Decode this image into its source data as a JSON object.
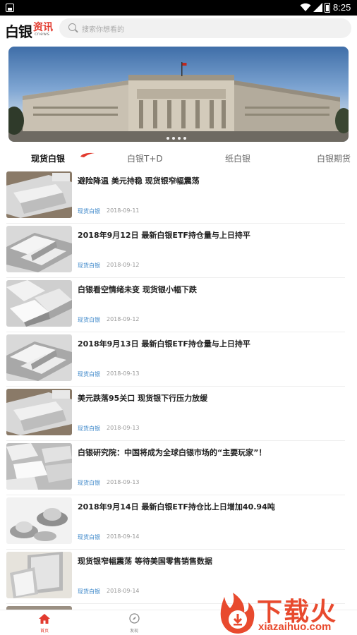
{
  "status_bar": {
    "time": "8:25"
  },
  "header": {
    "logo_main": "白银",
    "logo_accent": "资讯",
    "logo_sub": "cnews",
    "search_placeholder": "搜索你想看的"
  },
  "tabs": [
    {
      "label": "现货白银",
      "active": true
    },
    {
      "label": "白银T+D",
      "active": false
    },
    {
      "label": "纸白银",
      "active": false
    },
    {
      "label": "白银期货",
      "active": false
    }
  ],
  "news": [
    {
      "title": "避险降温 美元持稳 现货银窄幅震荡",
      "tag": "现货白银",
      "date": "2018-09-11"
    },
    {
      "title": "2018年9月12日 最新白银ETF持仓量与上日持平",
      "tag": "现货白银",
      "date": "2018-09-12"
    },
    {
      "title": "白银看空情绪未变 现货银小幅下跌",
      "tag": "现货白银",
      "date": "2018-09-12"
    },
    {
      "title": "2018年9月13日 最新白银ETF持仓量与上日持平",
      "tag": "现货白银",
      "date": "2018-09-13"
    },
    {
      "title": "美元跌落95关口 现货银下行压力放缓",
      "tag": "现货白银",
      "date": "2018-09-13"
    },
    {
      "title": "白银研究院：中国将成为全球白银市场的“主要玩家”！",
      "tag": "现货白银",
      "date": "2018-09-13"
    },
    {
      "title": "2018年9月14日 最新白银ETF持仓比上日增加40.94吨",
      "tag": "现货白银",
      "date": "2018-09-14"
    },
    {
      "title": "现货银窄幅震荡 等待美国零售销售数据",
      "tag": "现货白银",
      "date": "2018-09-14"
    }
  ],
  "bottom_nav": [
    {
      "label": "首页",
      "icon": "home-icon",
      "active": true
    },
    {
      "label": "发现",
      "icon": "compass-icon",
      "active": false
    }
  ],
  "watermark": {
    "text_cn": "下载火",
    "text_en": "xiazaihuo.com"
  },
  "colors": {
    "accent": "#e23a2e",
    "tag": "#3a86c9"
  }
}
